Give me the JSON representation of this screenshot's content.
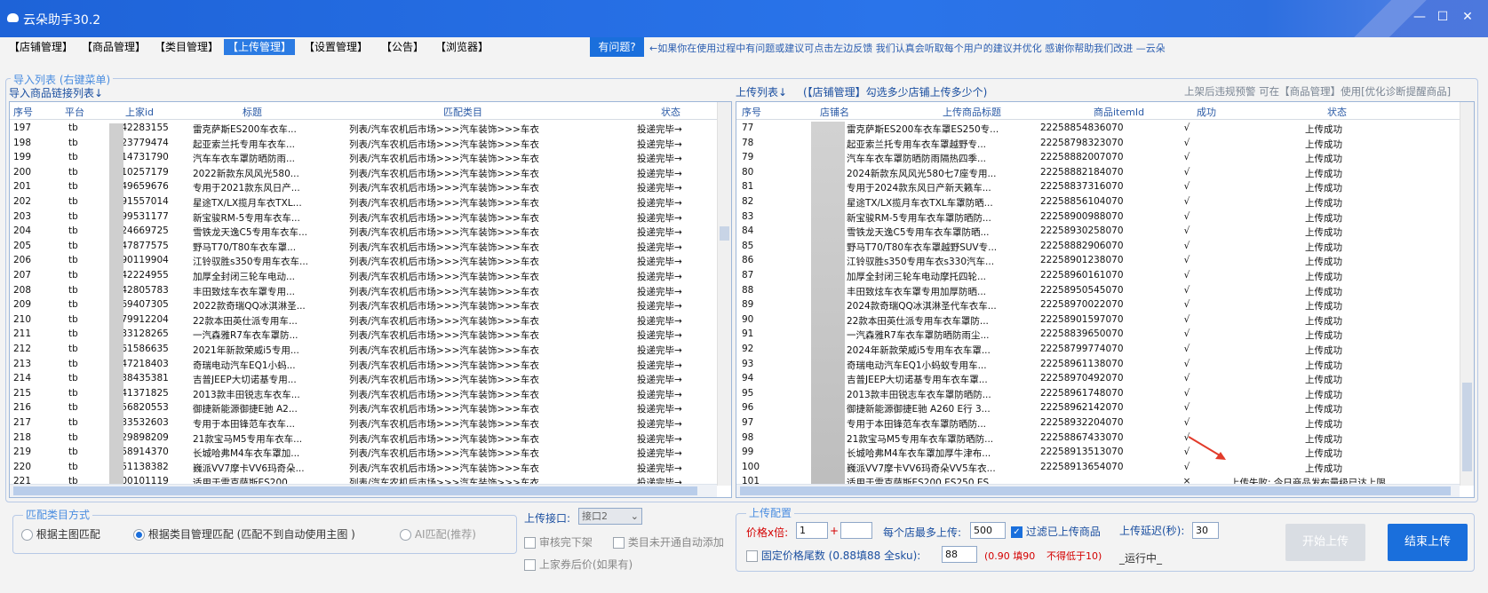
{
  "app": {
    "title": "云朵助手30.2"
  },
  "menu": {
    "items": [
      "【店铺管理】",
      "【商品管理】",
      "【类目管理】",
      "【上传管理】",
      "【设置管理】",
      "【公告】",
      "【浏览器】"
    ],
    "active_index": 3
  },
  "help": {
    "button_label": "有问题?",
    "notice": "←如果你在使用过程中有问题或建议可点击左边反馈 我们认真会听取每个用户的建议并优化 感谢你帮助我们改进 —云朵"
  },
  "import": {
    "group_label": "导入列表 (右键菜单)",
    "sub_label": "导入商品链接列表↓",
    "columns": [
      "序号",
      "平台",
      "上家id",
      "标题",
      "匹配类目",
      "状态"
    ],
    "rows": [
      [
        "197",
        "tb",
        "5442283155",
        "雷克萨斯ES200车衣车...",
        "列表/汽车农机后市场>>>汽车装饰>>>车衣",
        "投递完毕→"
      ],
      [
        "198",
        "tb",
        "6323779474",
        "起亚索兰托专用车衣车...",
        "列表/汽车农机后市场>>>汽车装饰>>>车衣",
        "投递完毕→"
      ],
      [
        "199",
        "tb",
        "7414731790",
        "汽车车衣车罩防晒防雨...",
        "列表/汽车农机后市场>>>汽车装饰>>>车衣",
        "投递完毕→"
      ],
      [
        "200",
        "tb",
        "1010257179",
        "2022新款东风风光580...",
        "列表/汽车农机后市场>>>汽车装饰>>>车衣",
        "投递完毕→"
      ],
      [
        "201",
        "tb",
        "0949659676",
        "专用于2021款东风日产...",
        "列表/汽车农机后市场>>>汽车装饰>>>车衣",
        "投递完毕→"
      ],
      [
        "202",
        "tb",
        "0791557014",
        "星途TX/LX揽月车衣TXL...",
        "列表/汽车农机后市场>>>汽车装饰>>>车衣",
        "投递完毕→"
      ],
      [
        "203",
        "tb",
        "6399531177",
        "新宝骏RM-5专用车衣车...",
        "列表/汽车农机后市场>>>汽车装饰>>>车衣",
        "投递完毕→"
      ],
      [
        "204",
        "tb",
        "5824669725",
        "雪铁龙天逸C5专用车衣车...",
        "列表/汽车农机后市场>>>汽车装饰>>>车衣",
        "投递完毕→"
      ],
      [
        "205",
        "tb",
        "5747877575",
        "野马T70/T80车衣车罩...",
        "列表/汽车农机后市场>>>汽车装饰>>>车衣",
        "投递完毕→"
      ],
      [
        "206",
        "tb",
        "4990119904",
        "江铃驭胜s350专用车衣车...",
        "列表/汽车农机后市场>>>汽车装饰>>>车衣",
        "投递完毕→"
      ],
      [
        "207",
        "tb",
        "0642224955",
        "加厚全封闭三轮车电动...",
        "列表/汽车农机后市场>>>汽车装饰>>>车衣",
        "投递完毕→"
      ],
      [
        "208",
        "tb",
        "5142805783",
        "丰田致炫车衣车罩专用...",
        "列表/汽车农机后市场>>>汽车装饰>>>车衣",
        "投递完毕→"
      ],
      [
        "209",
        "tb",
        "0469407305",
        "2022款奇瑞QQ冰淇淋圣...",
        "列表/汽车农机后市场>>>汽车装饰>>>车衣",
        "投递完毕→"
      ],
      [
        "210",
        "tb",
        "0279912204",
        "22款本田英仕派专用车...",
        "列表/汽车农机后市场>>>汽车装饰>>>车衣",
        "投递完毕→"
      ],
      [
        "211",
        "tb",
        "8333128265",
        "一汽森雅R7车衣车罩防...",
        "列表/汽车农机后市场>>>汽车装饰>>>车衣",
        "投递完毕→"
      ],
      [
        "212",
        "tb",
        "0261586635",
        "2021年新款荣威i5专用...",
        "列表/汽车农机后市场>>>汽车装饰>>>车衣",
        "投递完毕→"
      ],
      [
        "213",
        "tb",
        "9347218403",
        "奇瑞电动汽车EQ1小蚂...",
        "列表/汽车农机后市场>>>汽车装饰>>>车衣",
        "投递完毕→"
      ],
      [
        "214",
        "tb",
        "6138435381",
        "吉普JEEP大切诺基专用...",
        "列表/汽车农机后市场>>>汽车装饰>>>车衣",
        "投递完毕→"
      ],
      [
        "215",
        "tb",
        "5441371825",
        "2013款丰田锐志车衣车...",
        "列表/汽车农机后市场>>>汽车装饰>>>车衣",
        "投递完毕→"
      ],
      [
        "216",
        "tb",
        "8156820553",
        "御捷新能源御捷E驰 A2...",
        "列表/汽车农机后市场>>>汽车装饰>>>车衣",
        "投递完毕→"
      ],
      [
        "217",
        "tb",
        "0333532603",
        "专用于本田锋范车衣车...",
        "列表/汽车农机后市场>>>汽车装饰>>>车衣",
        "投递完毕→"
      ],
      [
        "218",
        "tb",
        "0629898209",
        "21款宝马M5专用车衣车...",
        "列表/汽车农机后市场>>>汽车装饰>>>车衣",
        "投递完毕→"
      ],
      [
        "219",
        "tb",
        "5458914370",
        "长城哈弗M4车衣车罩加...",
        "列表/汽车农机后市场>>>汽车装饰>>>车衣",
        "投递完毕→"
      ],
      [
        "220",
        "tb",
        "8351138382",
        "巍派VV7摩卡VV6玛奇朵...",
        "列表/汽车农机后市场>>>汽车装饰>>>车衣",
        "投递完毕→"
      ],
      [
        "221",
        "tb",
        "0000101119",
        "适用于雷克萨斯ES200 ...",
        "列表/汽车农机后市场>>>汽车装饰>>>车衣",
        "投递完毕→"
      ]
    ]
  },
  "upload": {
    "list_label": "上传列表↓",
    "store_hint": "(【店铺管理】勾选多少店铺上传多少个)",
    "right_hint": "上架后违规预警 可在【商品管理】使用[优化诊断提醒商品]",
    "columns": [
      "序号",
      "店铺名",
      "上传商品标题",
      "商品itemId",
      "成功",
      "状态"
    ],
    "rows": [
      [
        "77",
        "雷克萨斯ES200车衣车罩ES250专...",
        "22258854836070",
        "√",
        "上传成功"
      ],
      [
        "78",
        "起亚索兰托专用车衣车罩越野专...",
        "22258798323070",
        "√",
        "上传成功"
      ],
      [
        "79",
        "汽车车衣车罩防晒防雨隔热四季...",
        "22258882007070",
        "√",
        "上传成功"
      ],
      [
        "80",
        "2024新款东风风光580七7座专用...",
        "22258882184070",
        "√",
        "上传成功"
      ],
      [
        "81",
        "专用于2024款东风日产新天籁车...",
        "22258837316070",
        "√",
        "上传成功"
      ],
      [
        "82",
        "星途TX/LX揽月车衣TXL车罩防晒...",
        "22258856104070",
        "√",
        "上传成功"
      ],
      [
        "83",
        "新宝骏RM-5专用车衣车罩防晒防...",
        "22258900988070",
        "√",
        "上传成功"
      ],
      [
        "84",
        "雪铁龙天逸C5专用车衣车罩防晒...",
        "22258930258070",
        "√",
        "上传成功"
      ],
      [
        "85",
        "野马T70/T80车衣车罩越野SUV专...",
        "22258882906070",
        "√",
        "上传成功"
      ],
      [
        "86",
        "江铃驭胜s350专用车衣s330汽车...",
        "22258901238070",
        "√",
        "上传成功"
      ],
      [
        "87",
        "加厚全封闭三轮车电动摩托四轮...",
        "22258960161070",
        "√",
        "上传成功"
      ],
      [
        "88",
        "丰田致炫车衣车罩专用加厚防晒...",
        "22258950545070",
        "√",
        "上传成功"
      ],
      [
        "89",
        "2024款奇瑞QQ冰淇淋圣代车衣车...",
        "22258970022070",
        "√",
        "上传成功"
      ],
      [
        "90",
        "22款本田英仕派专用车衣车罩防...",
        "22258901597070",
        "√",
        "上传成功"
      ],
      [
        "91",
        "一汽森雅R7车衣车罩防晒防雨尘...",
        "22258839650070",
        "√",
        "上传成功"
      ],
      [
        "92",
        "2024年新款荣威i5专用车衣车罩...",
        "22258799774070",
        "√",
        "上传成功"
      ],
      [
        "93",
        "奇瑞电动汽车EQ1小蚂蚁专用车...",
        "22258961138070",
        "√",
        "上传成功"
      ],
      [
        "94",
        "吉普JEEP大切诺基专用车衣车罩...",
        "22258970492070",
        "√",
        "上传成功"
      ],
      [
        "95",
        "2013款丰田锐志车衣车罩防晒防...",
        "22258961748070",
        "√",
        "上传成功"
      ],
      [
        "96",
        "御捷新能源御捷E驰 A260 E行 3...",
        "22258962142070",
        "√",
        "上传成功"
      ],
      [
        "97",
        "专用于本田锋范车衣车罩防晒防...",
        "22258932204070",
        "√",
        "上传成功"
      ],
      [
        "98",
        "21款宝马M5专用车衣车罩防晒防...",
        "22258867433070",
        "√",
        "上传成功"
      ],
      [
        "99",
        "长城哈弗M4车衣车罩加厚牛津布...",
        "22258913513070",
        "√",
        "上传成功"
      ],
      [
        "100",
        "巍派VV7摩卡VV6玛奇朵VV5车衣...",
        "22258913654070",
        "√",
        "上传成功"
      ],
      [
        "101",
        "适用于雷克萨斯ES200 ES250 ES...",
        "",
        "×",
        "上传失败: 今日商品发布量级已达上限, ..."
      ]
    ]
  },
  "match": {
    "group_label": "匹配类目方式",
    "options": [
      "根据主图匹配",
      "根据类目管理匹配 (匹配不到自动使用主图 )",
      "AI匹配(推荐)"
    ],
    "selected_index": 1
  },
  "upload_port": {
    "label": "上传接口:",
    "value": "接口2",
    "checks": [
      {
        "label": "审核完下架",
        "checked": false
      },
      {
        "label": "类目未开通自动添加",
        "checked": false
      },
      {
        "label": "上家券后价(如果有)",
        "checked": false
      }
    ]
  },
  "config": {
    "group_label": "上传配置",
    "price_label": "价格x倍:",
    "price_value": "1",
    "plus_sign": "+",
    "plus_value": "",
    "max_label": "每个店最多上传:",
    "max_value": "500",
    "filter_label": "过滤已上传商品",
    "filter_checked": true,
    "delay_label": "上传延迟(秒):",
    "delay_value": "30",
    "fixed_label": "固定价格尾数 (0.88填88 全sku):",
    "fixed_value": "88",
    "fixed_hint_a": "(0.90 填90",
    "fixed_hint_b": "不得低于10)",
    "running": "_运行中_",
    "start_label": "开始上传",
    "stop_label": "结束上传"
  },
  "colors": {
    "titlebar": "#2a6fe2",
    "accent": "#1a6fdc",
    "link": "#2a5db0",
    "danger": "#d40000"
  }
}
